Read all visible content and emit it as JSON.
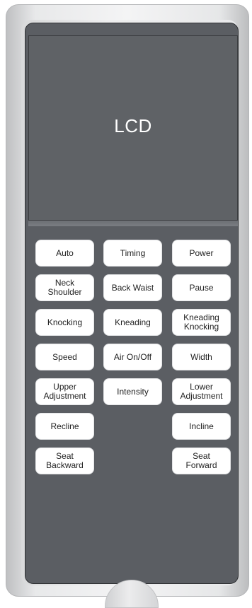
{
  "lcd": {
    "label": "LCD"
  },
  "buttons": {
    "auto": "Auto",
    "timing": "Timing",
    "power": "Power",
    "neck_shoulder": "Neck\nShoulder",
    "back_waist": "Back Waist",
    "pause": "Pause",
    "knocking": "Knocking",
    "kneading": "Kneading",
    "kneading_knocking": "Kneading\nKnocking",
    "speed": "Speed",
    "air_on_off": "Air On/Off",
    "width": "Width",
    "upper_adjustment": "Upper\nAdjustment",
    "intensity": "Intensity",
    "lower_adjustment": "Lower\nAdjustment",
    "recline": "Recline",
    "incline": "Incline",
    "seat_backward": "Seat\nBackward",
    "seat_forward": "Seat\nForward"
  },
  "colors": {
    "panel": "#5b5e63",
    "lcd": "#5f6266",
    "key": "#ffffff",
    "key_text": "#222222",
    "shell": "#ececed"
  }
}
